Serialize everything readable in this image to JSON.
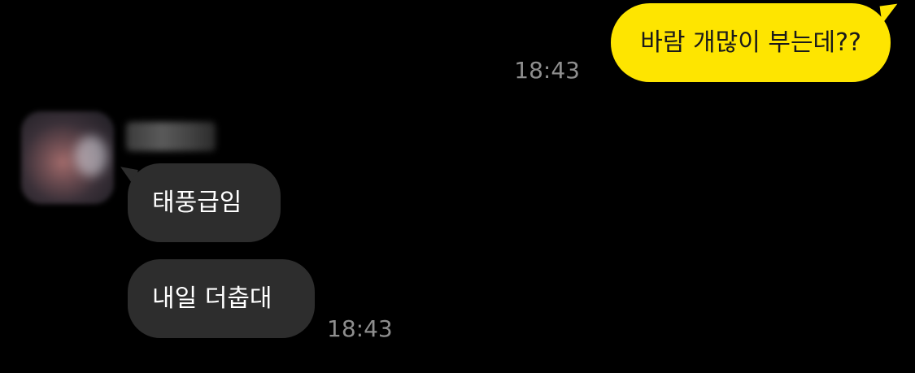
{
  "outgoing": {
    "message": "바람 개많이 부는데??",
    "time": "18:43"
  },
  "incoming": {
    "sender_name": "",
    "messages": [
      {
        "text": "태풍급임"
      },
      {
        "text": "내일 더춥대"
      }
    ],
    "time": "18:43"
  },
  "colors": {
    "background": "#000000",
    "outgoing_bubble": "#FEE500",
    "incoming_bubble": "#2d2d2d",
    "timestamp": "#8e8e8e"
  }
}
